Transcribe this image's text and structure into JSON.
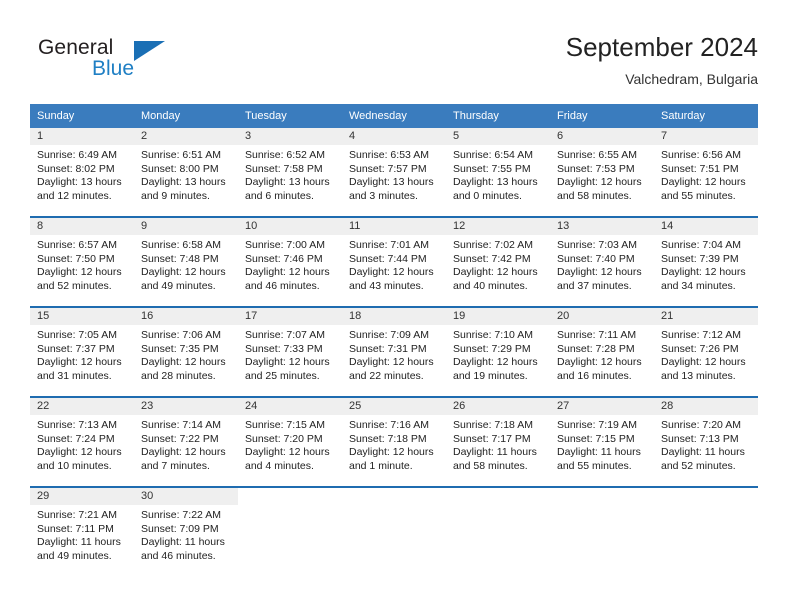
{
  "brand": {
    "word_one": "General",
    "word_two": "Blue",
    "triangle": "blue-triangle-icon"
  },
  "header": {
    "title": "September 2024",
    "subtitle": "Valchedram, Bulgaria"
  },
  "colors": {
    "header_blue": "#3a7cbe",
    "row_divider_blue": "#1f6cb0",
    "daynum_bg": "#efefef",
    "brand_blue": "#1f7fc4"
  },
  "weekdays": [
    "Sunday",
    "Monday",
    "Tuesday",
    "Wednesday",
    "Thursday",
    "Friday",
    "Saturday"
  ],
  "labels": {
    "sunrise_prefix": "Sunrise:",
    "sunset_prefix": "Sunset:",
    "daylight_prefix": "Daylight:"
  },
  "weeks": [
    [
      {
        "day": "1",
        "sunrise": "Sunrise: 6:49 AM",
        "sunset": "Sunset: 8:02 PM",
        "daylight": "Daylight: 13 hours and 12 minutes."
      },
      {
        "day": "2",
        "sunrise": "Sunrise: 6:51 AM",
        "sunset": "Sunset: 8:00 PM",
        "daylight": "Daylight: 13 hours and 9 minutes."
      },
      {
        "day": "3",
        "sunrise": "Sunrise: 6:52 AM",
        "sunset": "Sunset: 7:58 PM",
        "daylight": "Daylight: 13 hours and 6 minutes."
      },
      {
        "day": "4",
        "sunrise": "Sunrise: 6:53 AM",
        "sunset": "Sunset: 7:57 PM",
        "daylight": "Daylight: 13 hours and 3 minutes."
      },
      {
        "day": "5",
        "sunrise": "Sunrise: 6:54 AM",
        "sunset": "Sunset: 7:55 PM",
        "daylight": "Daylight: 13 hours and 0 minutes."
      },
      {
        "day": "6",
        "sunrise": "Sunrise: 6:55 AM",
        "sunset": "Sunset: 7:53 PM",
        "daylight": "Daylight: 12 hours and 58 minutes."
      },
      {
        "day": "7",
        "sunrise": "Sunrise: 6:56 AM",
        "sunset": "Sunset: 7:51 PM",
        "daylight": "Daylight: 12 hours and 55 minutes."
      }
    ],
    [
      {
        "day": "8",
        "sunrise": "Sunrise: 6:57 AM",
        "sunset": "Sunset: 7:50 PM",
        "daylight": "Daylight: 12 hours and 52 minutes."
      },
      {
        "day": "9",
        "sunrise": "Sunrise: 6:58 AM",
        "sunset": "Sunset: 7:48 PM",
        "daylight": "Daylight: 12 hours and 49 minutes."
      },
      {
        "day": "10",
        "sunrise": "Sunrise: 7:00 AM",
        "sunset": "Sunset: 7:46 PM",
        "daylight": "Daylight: 12 hours and 46 minutes."
      },
      {
        "day": "11",
        "sunrise": "Sunrise: 7:01 AM",
        "sunset": "Sunset: 7:44 PM",
        "daylight": "Daylight: 12 hours and 43 minutes."
      },
      {
        "day": "12",
        "sunrise": "Sunrise: 7:02 AM",
        "sunset": "Sunset: 7:42 PM",
        "daylight": "Daylight: 12 hours and 40 minutes."
      },
      {
        "day": "13",
        "sunrise": "Sunrise: 7:03 AM",
        "sunset": "Sunset: 7:40 PM",
        "daylight": "Daylight: 12 hours and 37 minutes."
      },
      {
        "day": "14",
        "sunrise": "Sunrise: 7:04 AM",
        "sunset": "Sunset: 7:39 PM",
        "daylight": "Daylight: 12 hours and 34 minutes."
      }
    ],
    [
      {
        "day": "15",
        "sunrise": "Sunrise: 7:05 AM",
        "sunset": "Sunset: 7:37 PM",
        "daylight": "Daylight: 12 hours and 31 minutes."
      },
      {
        "day": "16",
        "sunrise": "Sunrise: 7:06 AM",
        "sunset": "Sunset: 7:35 PM",
        "daylight": "Daylight: 12 hours and 28 minutes."
      },
      {
        "day": "17",
        "sunrise": "Sunrise: 7:07 AM",
        "sunset": "Sunset: 7:33 PM",
        "daylight": "Daylight: 12 hours and 25 minutes."
      },
      {
        "day": "18",
        "sunrise": "Sunrise: 7:09 AM",
        "sunset": "Sunset: 7:31 PM",
        "daylight": "Daylight: 12 hours and 22 minutes."
      },
      {
        "day": "19",
        "sunrise": "Sunrise: 7:10 AM",
        "sunset": "Sunset: 7:29 PM",
        "daylight": "Daylight: 12 hours and 19 minutes."
      },
      {
        "day": "20",
        "sunrise": "Sunrise: 7:11 AM",
        "sunset": "Sunset: 7:28 PM",
        "daylight": "Daylight: 12 hours and 16 minutes."
      },
      {
        "day": "21",
        "sunrise": "Sunrise: 7:12 AM",
        "sunset": "Sunset: 7:26 PM",
        "daylight": "Daylight: 12 hours and 13 minutes."
      }
    ],
    [
      {
        "day": "22",
        "sunrise": "Sunrise: 7:13 AM",
        "sunset": "Sunset: 7:24 PM",
        "daylight": "Daylight: 12 hours and 10 minutes."
      },
      {
        "day": "23",
        "sunrise": "Sunrise: 7:14 AM",
        "sunset": "Sunset: 7:22 PM",
        "daylight": "Daylight: 12 hours and 7 minutes."
      },
      {
        "day": "24",
        "sunrise": "Sunrise: 7:15 AM",
        "sunset": "Sunset: 7:20 PM",
        "daylight": "Daylight: 12 hours and 4 minutes."
      },
      {
        "day": "25",
        "sunrise": "Sunrise: 7:16 AM",
        "sunset": "Sunset: 7:18 PM",
        "daylight": "Daylight: 12 hours and 1 minute."
      },
      {
        "day": "26",
        "sunrise": "Sunrise: 7:18 AM",
        "sunset": "Sunset: 7:17 PM",
        "daylight": "Daylight: 11 hours and 58 minutes."
      },
      {
        "day": "27",
        "sunrise": "Sunrise: 7:19 AM",
        "sunset": "Sunset: 7:15 PM",
        "daylight": "Daylight: 11 hours and 55 minutes."
      },
      {
        "day": "28",
        "sunrise": "Sunrise: 7:20 AM",
        "sunset": "Sunset: 7:13 PM",
        "daylight": "Daylight: 11 hours and 52 minutes."
      }
    ],
    [
      {
        "day": "29",
        "sunrise": "Sunrise: 7:21 AM",
        "sunset": "Sunset: 7:11 PM",
        "daylight": "Daylight: 11 hours and 49 minutes."
      },
      {
        "day": "30",
        "sunrise": "Sunrise: 7:22 AM",
        "sunset": "Sunset: 7:09 PM",
        "daylight": "Daylight: 11 hours and 46 minutes."
      },
      null,
      null,
      null,
      null,
      null
    ]
  ]
}
